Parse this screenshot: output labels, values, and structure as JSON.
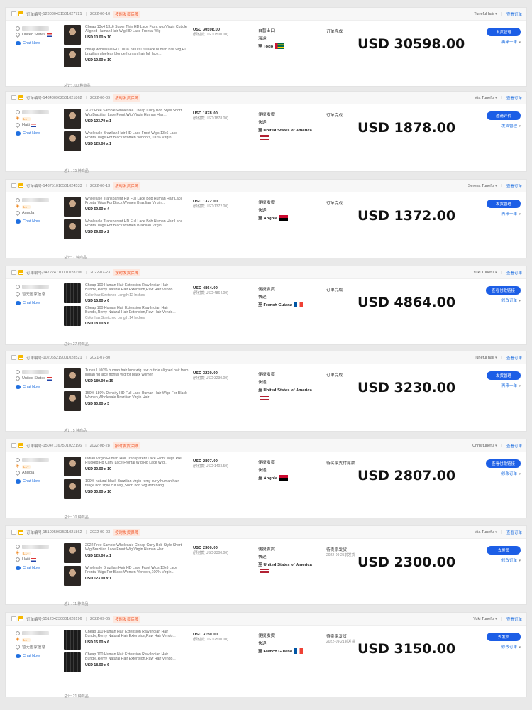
{
  "labels": {
    "order_no": "订单编号:",
    "chat": "Chat Now",
    "view_order": "查看订单",
    "total_prefix": "总计:",
    "total_suffix": "种商品",
    "to": "至"
  },
  "orders": [
    {
      "no": "123030431501027721",
      "date": "2022-06-10",
      "tag": "按时发货保障",
      "seller": "Tuneful hair",
      "buyer_level": "",
      "country": "United States",
      "products": [
        {
          "title": "Cheap 13x4 13x6 Super Thin HD Lace Front wig,Virgin Cuticle Aligned Human Hair Wig,HD Lace Frontal Wig",
          "price": "USD 10.00 x 10",
          "meta": ""
        },
        {
          "title": "cheap wholesale HD 100% natural full lace human hair wig,HD brazilian glueless blonde human hair full lace...",
          "price": "USD 10.00 x 10",
          "meta": ""
        }
      ],
      "total": "100",
      "amount": "USD 30598.00",
      "amount_sub": "(预付款 USD 7500.00)",
      "ship1": "自营出口",
      "ship2": "海运",
      "dest": "Togo",
      "status": "订单完成",
      "status_time": "",
      "big": "USD 30598.00",
      "btn": "发货管理",
      "link": "再来一单"
    },
    {
      "no": "143480962501021862",
      "date": "2022-06-09",
      "tag": "按时发货保障",
      "seller": "Mia Tuneful",
      "buyer_level": "L1+",
      "country": "Haiti",
      "products": [
        {
          "title": "2022 Free Sample Wholesale Cheap Curly Bob Style Short Wig Brazilian Lace Front Wig Virgin Human Hair...",
          "price": "USD 123.70 x 1",
          "meta": ""
        },
        {
          "title": "Wholesale Brazilian Hair HD Lace Front Wigs,13x6 Lace Frontal Wigs For Black Women Vendors,100% Virgin...",
          "price": "USD 123.00 x 1",
          "meta": ""
        }
      ],
      "total": "15",
      "amount": "USD 1878.00",
      "amount_sub": "(预付款 USD 1878.00)",
      "ship1": "便捷发货",
      "ship2": "快递",
      "dest": "United States of America",
      "status": "订单完成",
      "status_time": "",
      "big": "USD 1878.00",
      "btn": "邀请评价",
      "link": "发货管理"
    },
    {
      "no": "143751010501024533",
      "date": "2022-06-13",
      "tag": "按时发货保障",
      "seller": "Serena Tuneful",
      "buyer_level": "L1+",
      "country": "Angola",
      "products": [
        {
          "title": "Wholesale Transparent HD Full Lace Bob Human Hair Lace Frontal Wigs For Black Women Brazilian Virgin...",
          "price": "USD 59.00 x 4",
          "meta": ""
        },
        {
          "title": "Wholesale Transparent HD Full Lace Bob Human Hair Lace Frontal Wigs For Black Women Brazilian Virgin...",
          "price": "USD 29.00 x 2",
          "meta": ""
        }
      ],
      "total": "7",
      "amount": "USD 1372.00",
      "amount_sub": "(预付款 USD 1372.00)",
      "ship1": "便捷发货",
      "ship2": "快递",
      "dest": "Angola",
      "status": "订单完成",
      "status_time": "",
      "big": "USD 1372.00",
      "btn": "发货管理",
      "link": "再来一单"
    },
    {
      "no": "147224710001028196",
      "date": "2022-07-23",
      "tag": "按时发货保障",
      "seller": "Yuki Tuneful",
      "buyer_level": "",
      "country": "暂无国家信息",
      "products": [
        {
          "title": "Cheap 100 Human Hair Extension Raw Indian Hair Bundle,Remy Natural Hair Extension,Raw Hair Vendo...",
          "price": "USD 15.00 x 6",
          "meta": "Color:hair,Stretched Length:12 Inches"
        },
        {
          "title": "Cheap 100 Human Hair Extension Raw Indian Hair Bundle,Remy Natural Hair Extension,Raw Hair Vendo...",
          "price": "USD 18.00 x 6",
          "meta": "Color:hair,Stretched Length:14 Inches"
        }
      ],
      "total": "27",
      "amount": "USD 4864.00",
      "amount_sub": "(预付款 USD 4864.00)",
      "ship1": "便捷发货",
      "ship2": "快递",
      "dest": "French Guiana",
      "status": "订单完成",
      "status_time": "",
      "big": "USD 4864.00",
      "btn": "查看付款链接",
      "link": "修改订单"
    },
    {
      "no": "102065219001028521",
      "date": "2021-07-30",
      "tag": "",
      "seller": "Tuneful hair",
      "buyer_level": "",
      "country": "United States",
      "products": [
        {
          "title": "Tuneful 100% human hair lace wig raw cuticle aligned hair from indian hd lace frontal wig for black women",
          "price": "USD 180.00 x 15",
          "meta": ""
        },
        {
          "title": "150% 180% Density HD Full Lace Human Hair Wigs For Black Women,Wholesale Brazilian Virgin Hair...",
          "price": "USD 60.00 x 3",
          "meta": ""
        }
      ],
      "total": "5",
      "amount": "USD 3230.00",
      "amount_sub": "(预付款 USD 3230.00)",
      "ship1": "便捷发货",
      "ship2": "快递",
      "dest": "United States of America",
      "status": "订单完成",
      "status_time": "",
      "big": "USD 3230.00",
      "btn": "发货管理",
      "link": "再来一单"
    },
    {
      "no": "150471167501022196",
      "date": "2022-08-28",
      "tag": "按时发货保障",
      "seller": "Chris tuneful",
      "buyer_level": "L1+",
      "country": "Angola",
      "products": [
        {
          "title": "Indian Virgin Human Hair Transparent Lace Front Wigs Pre Plucked Hd Curly Lace Frontal Wig Hd Lace Wig...",
          "price": "USD 30.00 x 10",
          "meta": ""
        },
        {
          "title": "100% natural black Brazilian virgin remy curly human hair fringe bob style cut wig ,Short bob wig with bang...",
          "price": "USD 30.00 x 10",
          "meta": ""
        }
      ],
      "total": "10",
      "amount": "USD 2807.00",
      "amount_sub": "(预付款 USD 1403.50)",
      "ship1": "便捷发货",
      "ship2": "快递",
      "dest": "Angola",
      "status": "待买家支付尾款",
      "status_time": "",
      "big": "USD 2807.00",
      "btn": "查看付款链接",
      "link": "修改订单"
    },
    {
      "no": "151095963501021862",
      "date": "2022-09-03",
      "tag": "按时发货保障",
      "seller": "Mia Tuneful",
      "buyer_level": "L1+",
      "country": "Haiti",
      "products": [
        {
          "title": "2022 Free Sample Wholesale Cheap Curly Bob Style Short Wig Brazilian Lace Front Wig Virgin Human Hair...",
          "price": "USD 123.00 x 1",
          "meta": ""
        },
        {
          "title": "Wholesale Brazilian Hair HD Lace Front Wigs,13x6 Lace Frontal Wigs For Black Women Vendors,100% Virgin...",
          "price": "USD 123.00 x 1",
          "meta": ""
        }
      ],
      "total": "11",
      "amount": "USD 2300.00",
      "amount_sub": "(预付款 USD 2300.00)",
      "ship1": "便捷发货",
      "ship2": "快递",
      "dest": "United States of America",
      "status": "待卖家发货",
      "status_time": "2022-09-25前发货",
      "big": "USD 2300.00",
      "btn": "去发货",
      "link": "修改订单"
    },
    {
      "no": "151204230001028196",
      "date": "2022-09-05",
      "tag": "按时发货保障",
      "seller": "Yuki Tuneful",
      "buyer_level": "L1+",
      "country": "暂无国家信息",
      "products": [
        {
          "title": "Cheap 100 Human Hair Extension Raw Indian Hair Bundle,Remy Natural Hair Extension,Raw Hair Vendo...",
          "price": "USD 15.00 x 6",
          "meta": ""
        },
        {
          "title": "Cheap 100 Human Hair Extension Raw Indian Hair Bundle,Remy Natural Hair Extension,Raw Hair Vendo...",
          "price": "USD 18.00 x 6",
          "meta": ""
        }
      ],
      "total": "21",
      "amount": "USD 3150.00",
      "amount_sub": "(预付款 USD 2500.00)",
      "ship1": "便捷发货",
      "ship2": "快递",
      "dest": "French Guiana",
      "status": "待卖家发货",
      "status_time": "2022-09-21前发货",
      "big": "USD 3150.00",
      "btn": "去发货",
      "link": "修改订单"
    }
  ]
}
